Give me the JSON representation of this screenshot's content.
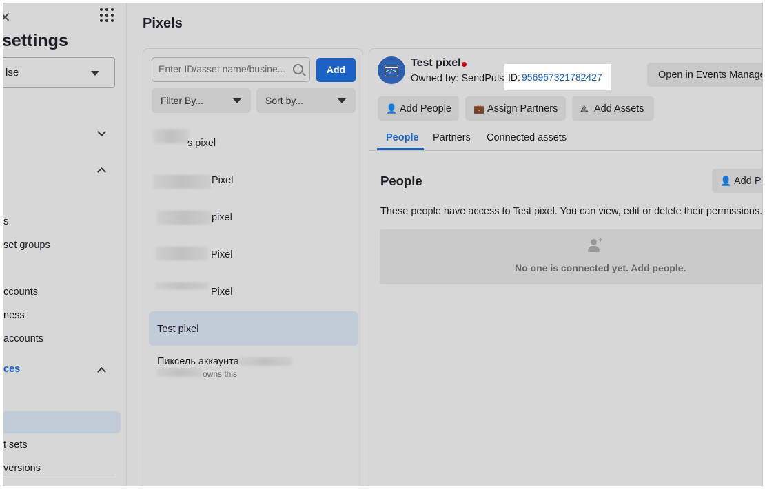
{
  "sidebar": {
    "title": "settings",
    "account_select": "lse",
    "items": [
      {
        "label": "s"
      },
      {
        "label": "set groups"
      },
      {
        "label": "ccounts"
      },
      {
        "label": "ness"
      },
      {
        "label": "accounts"
      },
      {
        "label": "ces"
      },
      {
        "label": "t sets"
      },
      {
        "label": "versions"
      }
    ]
  },
  "page": {
    "title": "Pixels"
  },
  "list": {
    "search_placeholder": "Enter ID/asset name/busine...",
    "add_label": "Add",
    "filter_label": "Filter By...",
    "sort_label": "Sort by...",
    "rows": [
      {
        "label": "s pixel"
      },
      {
        "label": "Pixel"
      },
      {
        "label": "pixel"
      },
      {
        "label": "Pixel"
      },
      {
        "label": "Pixel"
      },
      {
        "label": "Test pixel"
      },
      {
        "label": "Пиксель аккаунта",
        "sub": "owns this"
      }
    ]
  },
  "detail": {
    "name": "Test pixel",
    "status_color": "#d0021b",
    "owned_by": "Owned by: SendPulse",
    "id_label": "ID:",
    "id_value": "956967321782427",
    "open_events_label": "Open in Events Manager",
    "actions": {
      "add_people": "Add People",
      "assign_partners": "Assign Partners",
      "add_assets": "Add Assets"
    },
    "tabs": [
      "People",
      "Partners",
      "Connected assets"
    ],
    "section_title": "People",
    "add_people_short": "Add Pe",
    "description": "These people have access to Test pixel. You can view, edit or delete their permissions.",
    "empty_text": "No one is connected yet. Add people."
  },
  "colors": {
    "accent": "#1b62c4",
    "link": "#1a63c5",
    "selected_row": "#c2ccd8"
  }
}
